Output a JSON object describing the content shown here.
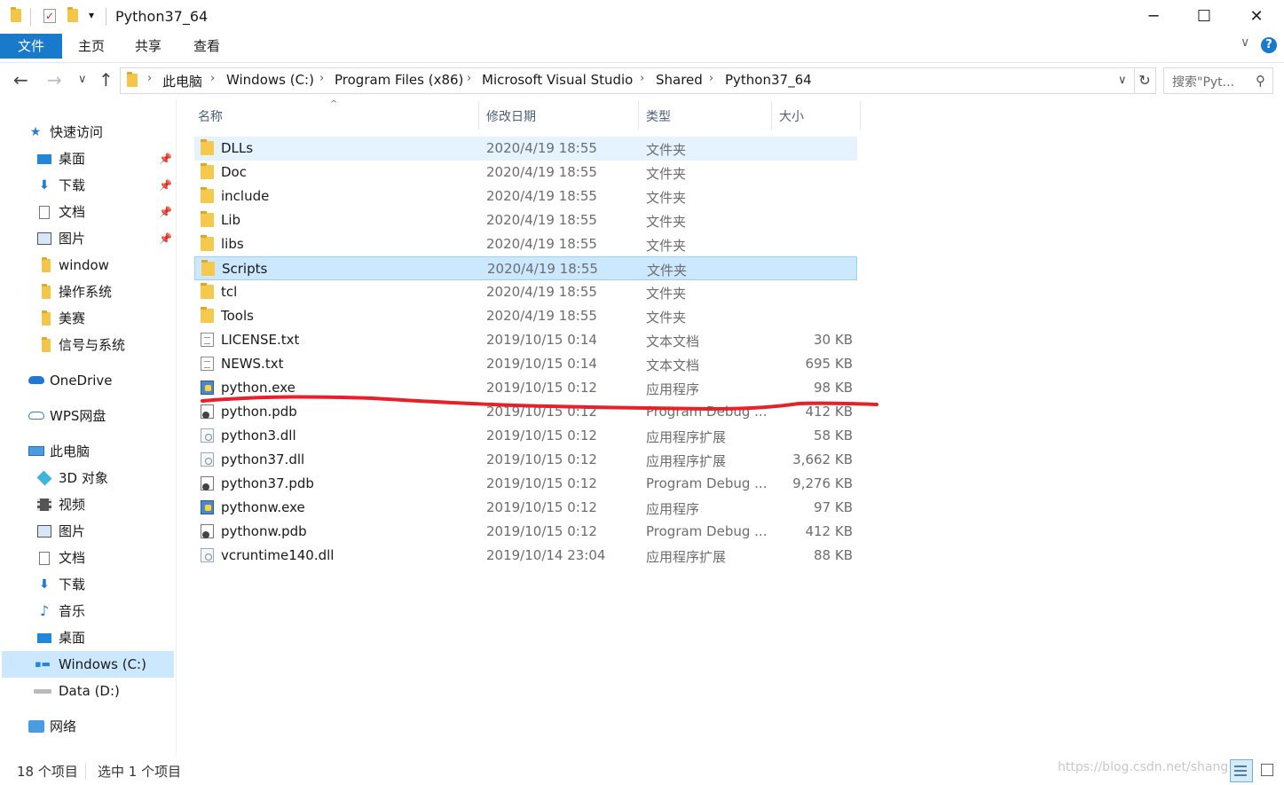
{
  "window": {
    "title": "Python37_64",
    "quick_access_customize": "▾",
    "minimize": "─",
    "maximize": "☐",
    "close": "✕"
  },
  "ribbon": {
    "tabs": [
      "文件",
      "主页",
      "共享",
      "查看"
    ],
    "collapse": "∨",
    "help": "?"
  },
  "navigation": {
    "back": "←",
    "forward": "→",
    "recent": "∨",
    "up": "↑",
    "breadcrumbs": [
      "此电脑",
      "Windows (C:)",
      "Program Files (x86)",
      "Microsoft Visual Studio",
      "Shared",
      "Python37_64"
    ],
    "dropdown": "∨",
    "refresh": "↻",
    "search_placeholder": "搜索\"Pyt...",
    "search_glyph": "⚲"
  },
  "sidebar": {
    "quick_access": "快速访问",
    "quick_items": [
      "桌面",
      "下载",
      "文档",
      "图片",
      "window",
      "操作系统",
      "美赛",
      "信号与系统"
    ],
    "onedrive": "OneDrive",
    "wps": "WPS网盘",
    "this_pc": "此电脑",
    "pc_items": [
      "3D 对象",
      "视频",
      "图片",
      "文档",
      "下载",
      "音乐",
      "桌面",
      "Windows (C:)",
      "Data (D:)"
    ],
    "network": "网络"
  },
  "columns": {
    "name": "名称",
    "date": "修改日期",
    "type": "类型",
    "size": "大小",
    "sort_indicator": "^"
  },
  "files": [
    {
      "name": "DLLs",
      "date": "2020/4/19 18:55",
      "type": "文件夹",
      "size": "",
      "icon": "folder-icon"
    },
    {
      "name": "Doc",
      "date": "2020/4/19 18:55",
      "type": "文件夹",
      "size": "",
      "icon": "folder-icon"
    },
    {
      "name": "include",
      "date": "2020/4/19 18:55",
      "type": "文件夹",
      "size": "",
      "icon": "folder-icon"
    },
    {
      "name": "Lib",
      "date": "2020/4/19 18:55",
      "type": "文件夹",
      "size": "",
      "icon": "folder-icon"
    },
    {
      "name": "libs",
      "date": "2020/4/19 18:55",
      "type": "文件夹",
      "size": "",
      "icon": "folder-icon"
    },
    {
      "name": "Scripts",
      "date": "2020/4/19 18:55",
      "type": "文件夹",
      "size": "",
      "icon": "folder-icon"
    },
    {
      "name": "tcl",
      "date": "2020/4/19 18:55",
      "type": "文件夹",
      "size": "",
      "icon": "folder-icon"
    },
    {
      "name": "Tools",
      "date": "2020/4/19 18:55",
      "type": "文件夹",
      "size": "",
      "icon": "folder-icon"
    },
    {
      "name": "LICENSE.txt",
      "date": "2019/10/15 0:14",
      "type": "文本文档",
      "size": "30 KB",
      "icon": "text-file-icon"
    },
    {
      "name": "NEWS.txt",
      "date": "2019/10/15 0:14",
      "type": "文本文档",
      "size": "695 KB",
      "icon": "text-file-icon"
    },
    {
      "name": "python.exe",
      "date": "2019/10/15 0:12",
      "type": "应用程序",
      "size": "98 KB",
      "icon": "python-exe-icon"
    },
    {
      "name": "python.pdb",
      "date": "2019/10/15 0:12",
      "type": "Program Debug ...",
      "size": "412 KB",
      "icon": "pdb-file-icon"
    },
    {
      "name": "python3.dll",
      "date": "2019/10/15 0:12",
      "type": "应用程序扩展",
      "size": "58 KB",
      "icon": "dll-file-icon"
    },
    {
      "name": "python37.dll",
      "date": "2019/10/15 0:12",
      "type": "应用程序扩展",
      "size": "3,662 KB",
      "icon": "dll-file-icon"
    },
    {
      "name": "python37.pdb",
      "date": "2019/10/15 0:12",
      "type": "Program Debug ...",
      "size": "9,276 KB",
      "icon": "pdb-file-icon"
    },
    {
      "name": "pythonw.exe",
      "date": "2019/10/15 0:12",
      "type": "应用程序",
      "size": "97 KB",
      "icon": "python-exe-icon"
    },
    {
      "name": "pythonw.pdb",
      "date": "2019/10/15 0:12",
      "type": "Program Debug ...",
      "size": "412 KB",
      "icon": "pdb-file-icon"
    },
    {
      "name": "vcruntime140.dll",
      "date": "2019/10/14 23:04",
      "type": "应用程序扩展",
      "size": "88 KB",
      "icon": "dll-file-icon"
    }
  ],
  "status": {
    "item_count": "18 个项目",
    "selected": "选中 1 个项目"
  },
  "watermark": "https://blog.csdn.net/shang",
  "colors": {
    "accent": "#1979ca",
    "selection": "#cce8ff",
    "hover": "#e5f3ff",
    "annotation": "#e8202a"
  }
}
